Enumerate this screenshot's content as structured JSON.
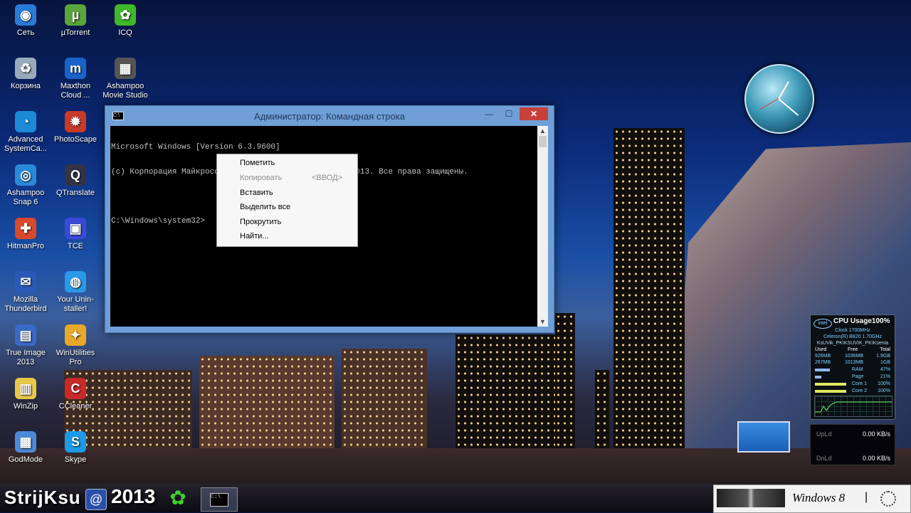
{
  "desktop_icons": [
    {
      "label": "Сеть",
      "icon": "network-icon"
    },
    {
      "label": "µTorrent",
      "icon": "utorrent-icon"
    },
    {
      "label": "ICQ",
      "icon": "icq-flower-icon"
    },
    {
      "label": "Корзина",
      "icon": "recycle-bin-icon"
    },
    {
      "label": "Maxthon Cloud ...",
      "icon": "maxthon-icon"
    },
    {
      "label": "Ashampoo Movie Studio",
      "icon": "film-icon"
    },
    {
      "label": "Advanced SystemCa...",
      "icon": "advanced-systemcare-icon"
    },
    {
      "label": "PhotoScape",
      "icon": "photoscape-icon"
    },
    {
      "label": "Ashampoo Snap 6",
      "icon": "camera-icon"
    },
    {
      "label": "QTranslate",
      "icon": "qtranslate-icon"
    },
    {
      "label": "HitmanPro",
      "icon": "hitmanpro-icon"
    },
    {
      "label": "TCE",
      "icon": "floppy-icon"
    },
    {
      "label": "Mozilla Thunderbird",
      "icon": "thunderbird-icon"
    },
    {
      "label": "Your Unin-staller!",
      "icon": "uninstaller-icon"
    },
    {
      "label": "True Image 2013",
      "icon": "true-image-icon"
    },
    {
      "label": "WinUtilities Pro",
      "icon": "winutilities-icon"
    },
    {
      "label": "WinZip",
      "icon": "winzip-icon"
    },
    {
      "label": "CCleaner",
      "icon": "ccleaner-icon"
    },
    {
      "label": "GodMode",
      "icon": "godmode-icon"
    },
    {
      "label": "Skype",
      "icon": "skype-icon"
    }
  ],
  "cmd_window": {
    "title": "Администратор: Командная строка",
    "app_icon_text": "C:\\",
    "minimize": "—",
    "maximize": "☐",
    "close": "✕",
    "lines": [
      "Microsoft Windows [Version 6.3.9600]",
      "(c) Корпорация Майкрософт (Microsoft Corporation), 2013. Все права защищены.",
      "",
      "C:\\Windows\\system32>"
    ]
  },
  "context_menu": {
    "items": [
      {
        "label": "Пометить",
        "enabled": true,
        "hint": ""
      },
      {
        "label": "Копировать",
        "enabled": false,
        "hint": "<ВВОД>"
      },
      {
        "label": "Вставить",
        "enabled": true,
        "hint": ""
      },
      {
        "label": "Выделить все",
        "enabled": true,
        "hint": ""
      },
      {
        "label": "Прокрутить",
        "enabled": true,
        "hint": ""
      },
      {
        "label": "Найти...",
        "enabled": true,
        "hint": ""
      }
    ]
  },
  "cpu_gadget": {
    "title": "CPU Usage100%",
    "brand": "intel",
    "clock": "Clock 1700MHz",
    "cpu_model": "Celeron(R) B820 1.70GHz",
    "user": "KsUVik_PK\\KSUVIK_PK\\Ksenia",
    "mem_headers": [
      "Used",
      "Free",
      "Total"
    ],
    "mem_rows": [
      [
        "926MB",
        "1036MB",
        "1.9GB"
      ],
      [
        "267MB",
        "1013MB",
        "1GB"
      ]
    ],
    "meters": [
      {
        "label": "RAM",
        "value": "47%",
        "fill": 0.47
      },
      {
        "label": "Page",
        "value": "21%",
        "fill": 0.21
      },
      {
        "label": "Core 1",
        "value": "100%",
        "fill": 1.0
      },
      {
        "label": "Core 2",
        "value": "100%",
        "fill": 1.0
      }
    ]
  },
  "net_gadget": {
    "up_label": "UpLd",
    "up_value": "0.00 KB/s",
    "down_label": "DnLd",
    "down_value": "0.00 KB/s"
  },
  "taskbar": {
    "watermark": "StrijKsu",
    "year": "2013",
    "win8_label": "Windows 8",
    "separator": "|"
  }
}
